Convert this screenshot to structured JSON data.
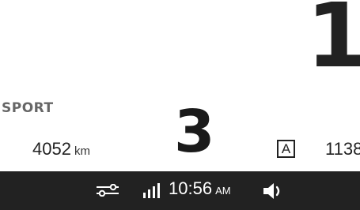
{
  "speed": {
    "value": "1"
  },
  "drive_mode": {
    "label": "SPORT"
  },
  "odometer": {
    "value": "4052",
    "unit": "km"
  },
  "gear": {
    "value": "3"
  },
  "transmission": {
    "mode": "A"
  },
  "trip": {
    "value": "1138"
  },
  "status_bar": {
    "time": "10:56",
    "ampm": "AM",
    "icons": [
      "settings-sliders-icon",
      "signal-icon",
      "volume-icon"
    ]
  },
  "colors": {
    "background": "#ffffff",
    "text": "#222222",
    "mode_text": "#666666",
    "status_bar_bg": "#222222",
    "status_bar_text": "#ffffff"
  }
}
